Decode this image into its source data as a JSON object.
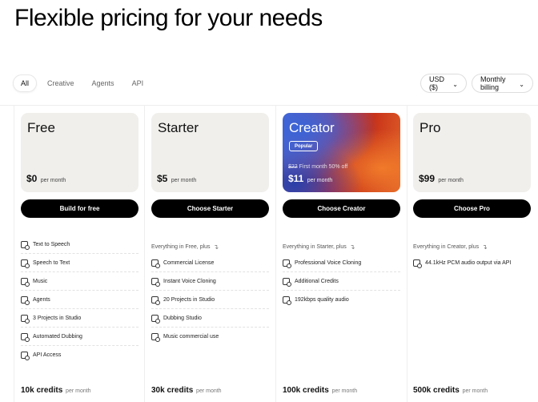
{
  "header": {
    "title": "Flexible pricing for your needs"
  },
  "filters": {
    "tabs": [
      {
        "label": "All",
        "active": true
      },
      {
        "label": "Creative",
        "active": false
      },
      {
        "label": "Agents",
        "active": false
      },
      {
        "label": "API",
        "active": false
      }
    ]
  },
  "selects": {
    "currency": "USD ($)",
    "billing": "Monthly billing"
  },
  "plans": [
    {
      "name": "Free",
      "price": "$0",
      "period": "per month",
      "cta": "Build for free",
      "everything": "",
      "features": [
        "Text to Speech",
        "Speech to Text",
        "Music",
        "Agents",
        "3 Projects in Studio",
        "Automated Dubbing",
        "API Access"
      ],
      "credits": "10k credits",
      "credits_period": "per month"
    },
    {
      "name": "Starter",
      "price": "$5",
      "period": "per month",
      "cta": "Choose Starter",
      "everything": "Everything in Free, plus",
      "features": [
        "Commercial License",
        "Instant Voice Cloning",
        "20 Projects in Studio",
        "Dubbing Studio",
        "Music commercial use"
      ],
      "credits": "30k credits",
      "credits_period": "per month"
    },
    {
      "name": "Creator",
      "badge": "Popular",
      "old_price": "$22",
      "promo": "First month 50% off",
      "price": "$11",
      "period": "per month",
      "cta": "Choose Creator",
      "everything": "Everything in Starter, plus",
      "features": [
        "Professional Voice Cloning",
        "Additional Credits",
        "192kbps quality audio"
      ],
      "credits": "100k credits",
      "credits_period": "per month"
    },
    {
      "name": "Pro",
      "price": "$99",
      "period": "per month",
      "cta": "Choose Pro",
      "everything": "Everything in Creator, plus",
      "features": [
        "44.1kHz PCM audio output via API"
      ],
      "credits": "500k credits",
      "credits_period": "per month"
    }
  ],
  "colors": {
    "accent": "#000000",
    "card_bg": "#f0efec",
    "divider": "#eeeeee"
  },
  "icons": {
    "feature": "voice-feature-icon",
    "dropdown": "chevron-down-icon",
    "plus_arrow": "curved-arrow-icon"
  }
}
